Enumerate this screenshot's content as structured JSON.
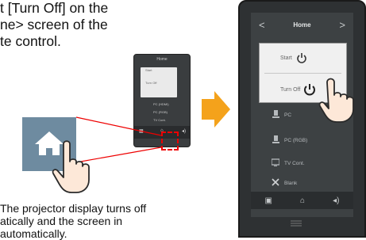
{
  "instruction": {
    "line1": "t [Turn Off] on the",
    "line2": "ne> screen of the",
    "line3": "te control."
  },
  "note": {
    "line1": "The projector display turns off",
    "line2": "atically and the screen in",
    "line3": "automatically."
  },
  "small_remote": {
    "title": "Home",
    "start_label": "Start",
    "turn_off_label": "Turn Off",
    "items": [
      "PC (HDMI)",
      "PC (RGB)",
      "TV Cont.",
      "Blank"
    ]
  },
  "remote": {
    "title": "Home",
    "prev_label": "<",
    "next_label": ">",
    "start_label": "Start",
    "turn_off_label": "Turn Off",
    "items": [
      {
        "label": "PC",
        "icon": "pc-icon"
      },
      {
        "label": "PC (RGB)",
        "icon": "pc-icon"
      },
      {
        "label": "TV Cont.",
        "icon": "tv-icon"
      },
      {
        "label": "Blank",
        "icon": "close-icon"
      }
    ],
    "bottom_icons": [
      "device-icon",
      "home-icon",
      "volume-icon"
    ],
    "handle_icon": "menu-icon"
  },
  "colors": {
    "highlight": "#e00000",
    "arrow": "#f4a21b",
    "remote_body": "#2e3133",
    "remote_screen": "#3d4143",
    "home_tile": "#6e8ba0"
  }
}
